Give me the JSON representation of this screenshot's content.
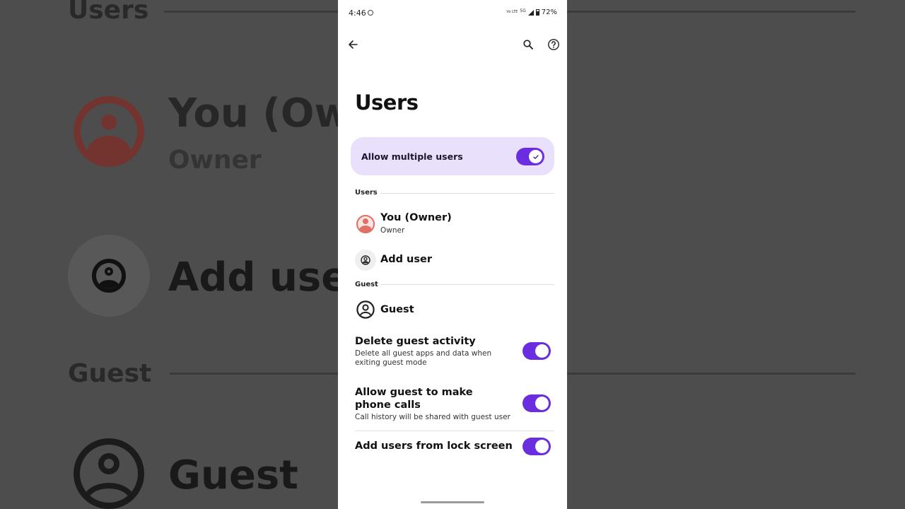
{
  "status_bar": {
    "time": "4:46",
    "network": "5G",
    "network_sub": "Vo LTE",
    "battery": "72%"
  },
  "toolbar": {
    "back_icon": "arrow-left-icon",
    "search_icon": "search-icon",
    "help_icon": "help-circle-icon"
  },
  "page": {
    "title": "Users"
  },
  "master_switch": {
    "label": "Allow multiple users",
    "enabled": true
  },
  "sections": {
    "users_header": "Users",
    "guest_header": "Guest"
  },
  "users": {
    "owner_name": "You (Owner)",
    "owner_role": "Owner",
    "add_user_label": "Add user"
  },
  "guest": {
    "label": "Guest",
    "settings": [
      {
        "title": "Delete guest activity",
        "subtitle": "Delete all guest apps and data when exiting guest mode",
        "enabled": true
      },
      {
        "title": "Allow guest to make phone calls",
        "subtitle": "Call history will be shared with guest user",
        "enabled": true
      },
      {
        "title": "Add users from lock screen",
        "subtitle": "",
        "enabled": true
      }
    ]
  },
  "background_zoom": {
    "title": "Users",
    "you": "You (Ow",
    "owner": "Owner",
    "add_user": "Add use",
    "guest_header": "Guest",
    "guest": "Guest"
  },
  "colors": {
    "accent": "#6a2de0",
    "master_bg": "#e9e1fb",
    "owner_avatar": "#e07066",
    "backdrop": "#4d4d4d"
  }
}
